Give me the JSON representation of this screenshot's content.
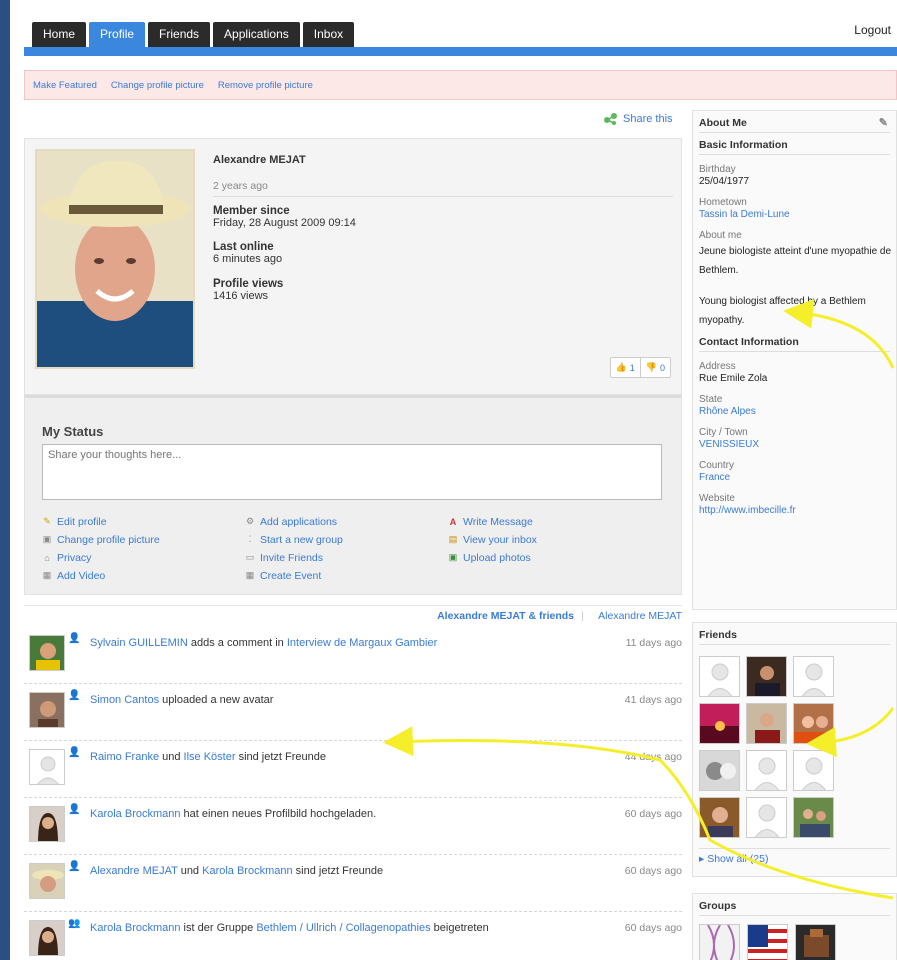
{
  "nav": {
    "tabs": [
      {
        "label": "Home"
      },
      {
        "label": "Profile"
      },
      {
        "label": "Friends"
      },
      {
        "label": "Applications"
      },
      {
        "label": "Inbox"
      }
    ],
    "logout": "Logout"
  },
  "actions": [
    "Make Featured",
    "Change profile picture",
    "Remove profile picture"
  ],
  "share": "Share this",
  "profile": {
    "name": "Alexandre MEJAT",
    "ago": "2 years ago",
    "member_since_label": "Member since",
    "member_since_value": "Friday, 28 August 2009 09:14",
    "last_online_label": "Last online",
    "last_online_value": "6 minutes ago",
    "views_label": "Profile views",
    "views_value": "1416 views",
    "likes": "1",
    "dislikes": "0"
  },
  "status": {
    "title": "My Status",
    "placeholder": "Share your thoughts here..."
  },
  "quicklinks": [
    {
      "label": "Edit profile",
      "icon": "pencil-icon",
      "glyph": "✎"
    },
    {
      "label": "Add applications",
      "icon": "gear-icon",
      "glyph": "⚙"
    },
    {
      "label": "Write Message",
      "icon": "letter-a-icon",
      "glyph": "A"
    },
    {
      "label": "Change profile picture",
      "icon": "picture-icon",
      "glyph": "▣"
    },
    {
      "label": "Start a new group",
      "icon": "group-icon",
      "glyph": "⁚"
    },
    {
      "label": "View your inbox",
      "icon": "inbox-icon",
      "glyph": "▤"
    },
    {
      "label": "Privacy",
      "icon": "lock-icon",
      "glyph": "⌂"
    },
    {
      "label": "Invite Friends",
      "icon": "invite-icon",
      "glyph": "▭"
    },
    {
      "label": "Upload photos",
      "icon": "photo-icon",
      "glyph": "▣"
    },
    {
      "label": "Add Video",
      "icon": "video-icon",
      "glyph": "▦"
    },
    {
      "label": "Create Event",
      "icon": "calendar-icon",
      "glyph": "▦"
    }
  ],
  "feed_head": {
    "friends": "Alexandre MEJAT & friends",
    "self": "Alexandre MEJAT"
  },
  "feed": [
    {
      "a": "Sylvain GUILLEMIN",
      "t1": " adds a comment in ",
      "b": "Interview de Margaux Gambier",
      "t2": "",
      "time": "11 days ago"
    },
    {
      "a": "Simon Cantos",
      "t1": " uploaded a new avatar",
      "b": "",
      "t2": "",
      "time": "41 days ago"
    },
    {
      "a": "Raimo Franke",
      "t1": " und ",
      "b": "Ilse Köster",
      "t2": " sind jetzt Freunde",
      "time": "44 days ago"
    },
    {
      "a": "Karola Brockmann",
      "t1": " hat einen neues Profilbild hochgeladen.",
      "b": "",
      "t2": "",
      "time": "60 days ago"
    },
    {
      "a": "Alexandre MEJAT",
      "t1": " und ",
      "b": "Karola Brockmann",
      "t2": " sind jetzt Freunde",
      "time": "60 days ago"
    },
    {
      "a": "Karola Brockmann",
      "t1": " ist der Gruppe ",
      "b": "Bethlem / Ullrich / Collagenopathies",
      "t2": " beigetreten",
      "time": "60 days ago"
    }
  ],
  "about": {
    "title": "About Me",
    "basic": "Basic Information",
    "birthday_label": "Birthday",
    "birthday": "25/04/1977",
    "hometown_label": "Hometown",
    "hometown": "Tassin la Demi-Lune",
    "aboutme_label": "About me",
    "aboutme_fr": "Jeune biologiste atteint d'une myopathie de Bethlem.",
    "aboutme_en": "Young biologist affected by a Bethlem myopathy.",
    "contact": "Contact Information",
    "address_label": "Address",
    "address": "Rue Emile Zola",
    "state_label": "State",
    "state": "Rhône Alpes",
    "city_label": "City / Town",
    "city": "VENISSIEUX",
    "country_label": "Country",
    "country": "France",
    "website_label": "Website",
    "website": "http://www.imbecille.fr"
  },
  "friends": {
    "title": "Friends",
    "show_all": "Show all (25)"
  },
  "groups": {
    "title": "Groups"
  },
  "colors": {
    "nav_active": "#3b87de",
    "nav_bg": "#2b2b2b",
    "link": "#3a7bd5",
    "arrow": "#f5ee2a",
    "background": "#2a4f83"
  }
}
